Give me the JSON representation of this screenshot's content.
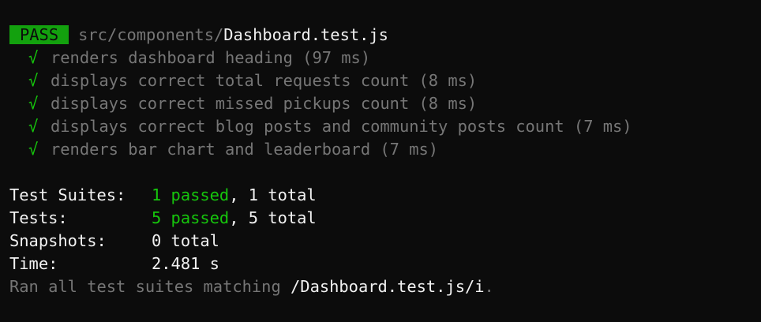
{
  "header": {
    "status": "PASS",
    "path_dir": "src/components/",
    "path_file": "Dashboard.test.js"
  },
  "tests": [
    {
      "icon": "√",
      "name": "renders dashboard heading (97 ms)"
    },
    {
      "icon": "√",
      "name": "displays correct total requests count (8 ms)"
    },
    {
      "icon": "√",
      "name": "displays correct missed pickups count (8 ms)"
    },
    {
      "icon": "√",
      "name": "displays correct blog posts and community posts count (7 ms)"
    },
    {
      "icon": "√",
      "name": "renders bar chart and leaderboard (7 ms)"
    }
  ],
  "summary": {
    "suites_label": "Test Suites:",
    "suites_passed": "1 passed",
    "suites_total": ", 1 total",
    "tests_label": "Tests:",
    "tests_passed": "5 passed",
    "tests_total": ", 5 total",
    "snapshots_label": "Snapshots:",
    "snapshots_value": "0 total",
    "time_label": "Time:",
    "time_value": "2.481 s",
    "ran_prefix": "Ran all test suites matching ",
    "ran_pattern": "/Dashboard.test.js/i",
    "ran_suffix": "."
  },
  "colors": {
    "background": "#0c0c0c",
    "pass_badge": "#13a10e",
    "green_text": "#16c60c",
    "dim_text": "#767676",
    "bright_text": "#f2f2f2"
  }
}
